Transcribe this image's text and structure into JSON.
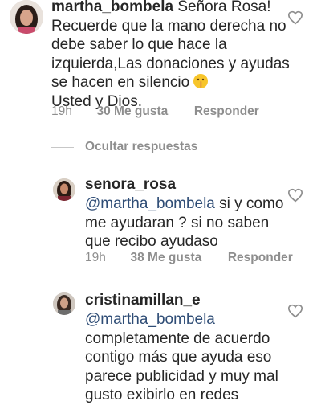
{
  "comments": [
    {
      "username": "martha_bombela",
      "text": "Señora Rosa! Recuerde que la mano derecha no debe saber lo que hace la izquierda,Las donaciones y ayudas se hacen en silencio",
      "text_end": "Usted y Dios.",
      "emoji": "shushing-face",
      "time": "19h",
      "likes": "30 Me gusta",
      "reply_label": "Responder"
    }
  ],
  "hide_replies_label": "Ocultar respuestas",
  "replies": [
    {
      "username": "senora_rosa",
      "mention": "@martha_bombela",
      "text": "si y como me ayudaran ? si no saben que recibo ayudaso",
      "time": "19h",
      "likes": "38 Me gusta",
      "reply_label": "Responder"
    },
    {
      "username": "cristinamillan_e",
      "mention": "@martha_bombela",
      "text": "completamente de acuerdo contigo más que ayuda eso parece publicidad y muy mal gusto exibirlo en redes"
    }
  ],
  "colors": {
    "mention": "#2f4d76",
    "meta": "#8e8e8e",
    "text": "#262626"
  }
}
